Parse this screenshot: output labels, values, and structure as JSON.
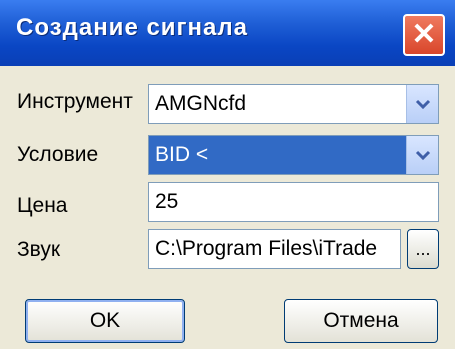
{
  "dialog": {
    "title": "Создание сигнала",
    "close_label": "✕"
  },
  "form": {
    "instrument_label": "Инструмент",
    "instrument_value": "AMGNcfd",
    "condition_label": "Условие",
    "condition_value": "BID <",
    "price_label": "Цена",
    "price_value": "25",
    "sound_label": "Звук",
    "sound_value": "C:\\Program Files\\iTrade",
    "browse_label": "..."
  },
  "buttons": {
    "ok_label": "OK",
    "cancel_label": "Отмена"
  },
  "icons": {
    "close": "close-icon",
    "dropdown": "chevron-down-icon"
  }
}
